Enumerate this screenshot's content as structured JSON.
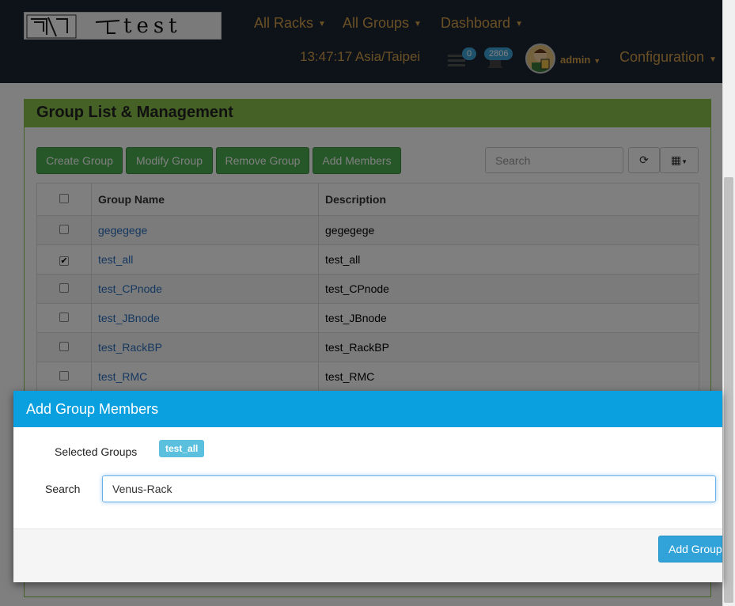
{
  "nav": {
    "logo_text": "test",
    "menus": [
      {
        "label": "All Racks"
      },
      {
        "label": "All Groups"
      },
      {
        "label": "Dashboard"
      }
    ],
    "clock": "13:47:17 Asia/Taipei",
    "list_badge": "0",
    "bell_badge": "2806",
    "user": "admin",
    "config": "Configuration"
  },
  "panel": {
    "title": "Group List & Management",
    "buttons": {
      "create": "Create Group",
      "modify": "Modify Group",
      "remove": "Remove Group",
      "add_members": "Add Members"
    },
    "search_placeholder": "Search",
    "columns": {
      "name": "Group Name",
      "description": "Description"
    },
    "rows": [
      {
        "name": "gegegege",
        "description": "gegegege",
        "checked": false
      },
      {
        "name": "test_all",
        "description": "test_all",
        "checked": true
      },
      {
        "name": "test_CPnode",
        "description": "test_CPnode",
        "checked": false
      },
      {
        "name": "test_JBnode",
        "description": "test_JBnode",
        "checked": false
      },
      {
        "name": "test_RackBP",
        "description": "test_RackBP",
        "checked": false
      },
      {
        "name": "test_RMC",
        "description": "test_RMC",
        "checked": false
      }
    ]
  },
  "modal": {
    "title": "Add Group Members",
    "selected_label": "Selected Groups",
    "selected_tag": "test_all",
    "search_label": "Search",
    "search_value": "Venus-Rack",
    "submit": "Add Group"
  },
  "colors": {
    "nav_bg": "#1c2433",
    "nav_text": "#d4a04a",
    "panel_accent": "#8bc34a",
    "modal_head": "#0aa0e0"
  }
}
